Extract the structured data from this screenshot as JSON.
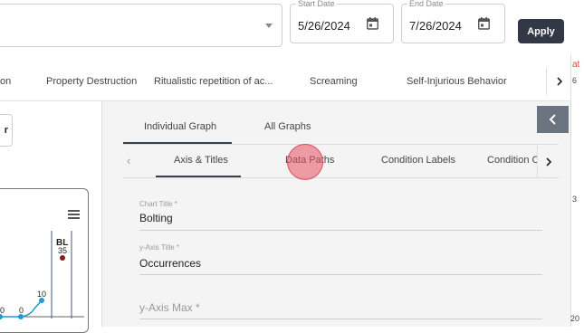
{
  "filters": {
    "start_date_label": "Start Date",
    "start_date_value": "5/26/2024",
    "end_date_label": "End Date",
    "end_date_value": "7/26/2024",
    "apply_label": "Apply",
    "edge_red_text": "at"
  },
  "behavior_tabs": [
    {
      "label": "on"
    },
    {
      "label": "Property Destruction"
    },
    {
      "label": "Ritualistic repetition of ac..."
    },
    {
      "label": "Screaming"
    },
    {
      "label": "Self-Injurious Behavior"
    }
  ],
  "left_chart": {
    "button_label": "r",
    "phase_label": "BL",
    "phase_value": "35",
    "point_labels": [
      "0",
      "0",
      "10"
    ]
  },
  "panel": {
    "tabs": [
      {
        "label": "Individual Graph"
      },
      {
        "label": "All Graphs"
      }
    ],
    "sub_tabs": [
      {
        "label": "Axis & Titles"
      },
      {
        "label": "Data Paths"
      },
      {
        "label": "Condition Labels"
      },
      {
        "label": "Condition C"
      }
    ],
    "fields": {
      "chart_title_label": "Chart Title *",
      "chart_title_value": "Bolting",
      "y_axis_title_label": "y-Axis Title *",
      "y_axis_title_value": "Occurrences",
      "y_axis_max_placeholder": "y-Axis Max *"
    }
  },
  "edge": {
    "numbers": [
      "6",
      "3",
      "20"
    ]
  },
  "colors": {
    "apply_bg": "#333846",
    "collapse_bg": "#6b7280",
    "active_underline": "#39404d",
    "chart_line": "#1f9bd1",
    "bl_marker": "#8b1a1a",
    "accent_red": "#e04a3a"
  },
  "icons": {
    "calendar": "calendar-icon",
    "chevron_right": "chevron-right-icon",
    "chevron_left": "chevron-left-icon",
    "menu": "hamburger-menu-icon",
    "dropdown": "caret-down-icon"
  }
}
